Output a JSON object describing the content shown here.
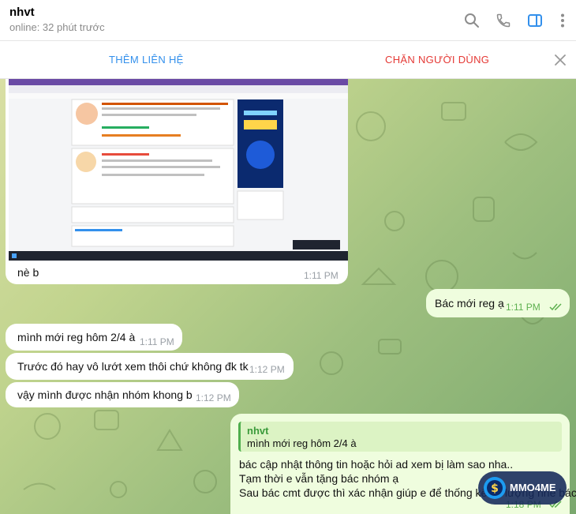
{
  "header": {
    "name": "nhvt",
    "status": "online: 32 phút trước",
    "icons": [
      "search-icon",
      "phone-icon",
      "sidebar-icon",
      "more-icon"
    ]
  },
  "actions": {
    "add_contact": "THÊM LIÊN HỆ",
    "block_user": "CHẶN NGƯỜI DÙNG"
  },
  "messages": [
    {
      "dir": "in",
      "type": "photo",
      "text": "nè b",
      "time": "1:11 PM"
    },
    {
      "dir": "out",
      "text": "Bác mới reg ạ",
      "time": "1:11 PM",
      "read": true
    },
    {
      "dir": "in",
      "text": "mình mới reg hôm 2/4 à",
      "time": "1:11 PM"
    },
    {
      "dir": "in",
      "text": "Trước đó hay vô lướt xem thôi chứ không đk tk",
      "time": "1:12 PM"
    },
    {
      "dir": "in",
      "text": "vậy mình được nhận nhóm khong b",
      "time": "1:12 PM"
    },
    {
      "dir": "out",
      "reply": {
        "name": "nhvt",
        "text": "mình mới reg hôm 2/4 à"
      },
      "lines": [
        "bác cập nhật thông tin hoặc hỏi ad xem bị làm sao nha..",
        "Tạm thời e vẫn tặng bác nhóm ạ",
        "Sau bác cmt được thì xác nhận giúp e để thống kế số lượng nhé bác"
      ],
      "time": "1:18 PM",
      "read": true
    }
  ],
  "watermark": {
    "text": "MMO4ME"
  },
  "colors": {
    "accent": "#3390ec",
    "danger": "#e53935",
    "outgoing": "#effdde",
    "check": "#5db04f"
  }
}
